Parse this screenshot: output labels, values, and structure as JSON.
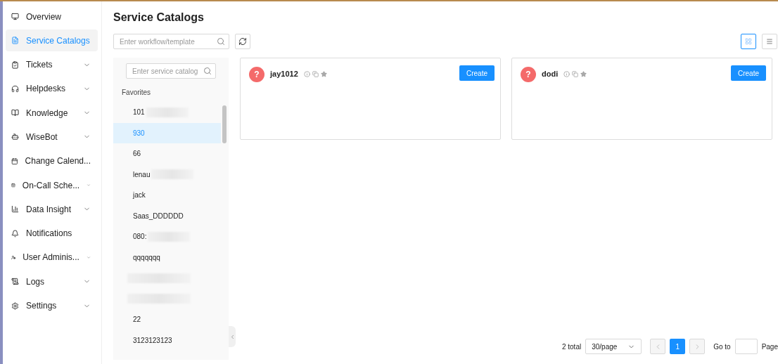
{
  "sidebar": {
    "items": [
      {
        "label": "Overview",
        "selected": false,
        "has_submenu": false
      },
      {
        "label": "Service Catalogs",
        "selected": true,
        "has_submenu": false
      },
      {
        "label": "Tickets",
        "selected": false,
        "has_submenu": true
      },
      {
        "label": "Helpdesks",
        "selected": false,
        "has_submenu": true
      },
      {
        "label": "Knowledge",
        "selected": false,
        "has_submenu": true
      },
      {
        "label": "WiseBot",
        "selected": false,
        "has_submenu": true
      },
      {
        "label": "Change Calend...",
        "selected": false,
        "has_submenu": false
      },
      {
        "label": "On-Call Sche...",
        "selected": false,
        "has_submenu": true
      },
      {
        "label": "Data Insight",
        "selected": false,
        "has_submenu": true
      },
      {
        "label": "Notifications",
        "selected": false,
        "has_submenu": false
      },
      {
        "label": "User Adminis...",
        "selected": false,
        "has_submenu": true
      },
      {
        "label": "Logs",
        "selected": false,
        "has_submenu": true
      },
      {
        "label": "Settings",
        "selected": false,
        "has_submenu": true
      }
    ]
  },
  "page": {
    "title": "Service Catalogs"
  },
  "toolbar": {
    "search": {
      "placeholder": "Enter workflow/template"
    },
    "view_modes": [
      {
        "selected": true
      },
      {
        "selected": false
      }
    ]
  },
  "catalogs": {
    "search": {
      "placeholder": "Enter service catalog"
    },
    "section": "Favorites",
    "items": [
      {
        "kind": "text",
        "label": "101",
        "blurred": true,
        "selected": false
      },
      {
        "kind": "text",
        "label": "930",
        "blurred": false,
        "selected": true
      },
      {
        "kind": "text",
        "label": "66",
        "blurred": false,
        "selected": false
      },
      {
        "kind": "text",
        "label": "lenau",
        "blurred": true,
        "selected": false
      },
      {
        "kind": "text",
        "label": "jack",
        "blurred": false,
        "selected": false
      },
      {
        "kind": "text",
        "label": "Saas_DDDDDD",
        "blurred": false,
        "selected": false
      },
      {
        "kind": "text",
        "label": "080:",
        "blurred": true,
        "selected": false
      },
      {
        "kind": "text",
        "label": "qqqqqqq",
        "blurred": false,
        "selected": false
      },
      {
        "kind": "redacted",
        "selected": false
      },
      {
        "kind": "redacted",
        "selected": false
      },
      {
        "kind": "text",
        "label": "22",
        "blurred": false,
        "selected": false
      },
      {
        "kind": "text",
        "label": "3123123123",
        "blurred": false,
        "selected": false
      }
    ]
  },
  "cards": [
    {
      "avatar": "?",
      "name": "jay1012",
      "button": "Create"
    },
    {
      "avatar": "?",
      "name": "dodi",
      "button": "Create"
    }
  ],
  "pagination": {
    "total": "2 total",
    "page_size": "30/page",
    "pages": [
      {
        "label": "1",
        "selected": true
      }
    ],
    "goto_label": "Go to",
    "page_label": "Page"
  }
}
